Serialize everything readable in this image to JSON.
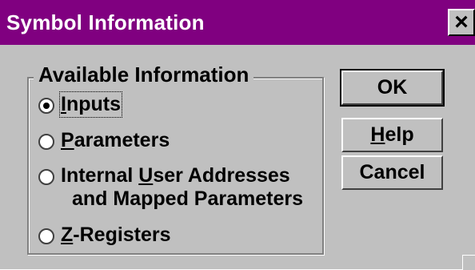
{
  "window": {
    "title": "Symbol Information",
    "close_glyph": "×"
  },
  "group": {
    "label": "Available Information"
  },
  "options": [
    {
      "pre": "",
      "accel": "I",
      "post": "nputs",
      "selected": true
    },
    {
      "pre": "",
      "accel": "P",
      "post": "arameters",
      "selected": false
    },
    {
      "pre": "Internal ",
      "accel": "U",
      "post": "ser Addresses",
      "line2": "and Mapped Parameters",
      "selected": false
    },
    {
      "pre": "",
      "accel": "Z",
      "post": "-Registers",
      "selected": false
    }
  ],
  "buttons": {
    "ok": {
      "label": "OK"
    },
    "help": {
      "pre": "",
      "accel": "H",
      "post": "elp"
    },
    "cancel": {
      "label": "Cancel"
    }
  },
  "colors": {
    "titlebar": "#800080",
    "face": "#c0c0c0"
  }
}
